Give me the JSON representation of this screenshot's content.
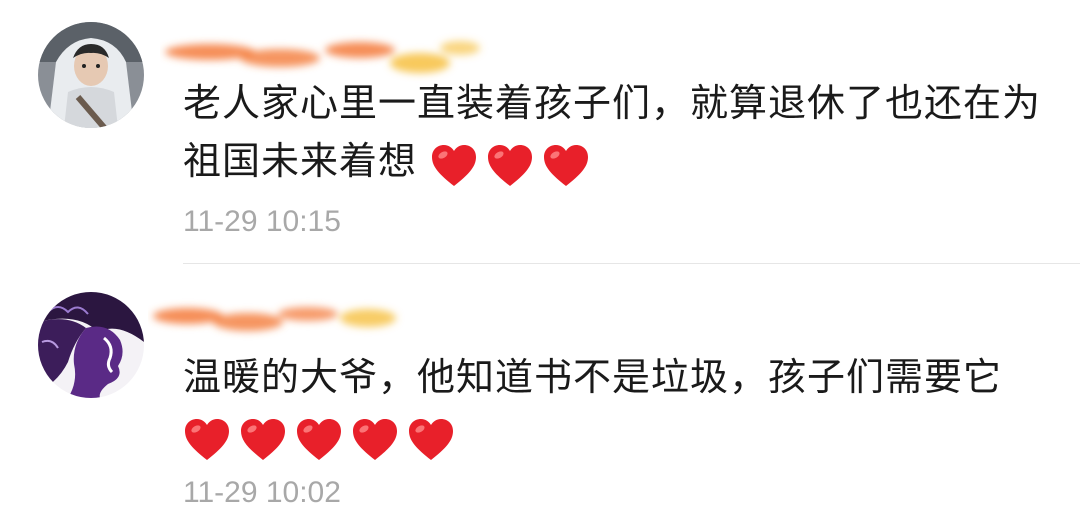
{
  "comments": [
    {
      "text": "老人家心里一直装着孩子们，就算退休了也还在为祖国未来着想",
      "heart_count": 3,
      "timestamp": "11-29 10:15"
    },
    {
      "text": "温暖的大爷，他知道书不是垃圾，孩子们需要它",
      "heart_count": 5,
      "timestamp": "11-29 10:02"
    }
  ],
  "colors": {
    "heart": "#e8202a",
    "name_blur_primary": "#f47a3a",
    "name_blur_secondary": "#f7c34a",
    "timestamp": "#a8a8a8"
  },
  "icons": {
    "reaction": "heart-icon"
  }
}
